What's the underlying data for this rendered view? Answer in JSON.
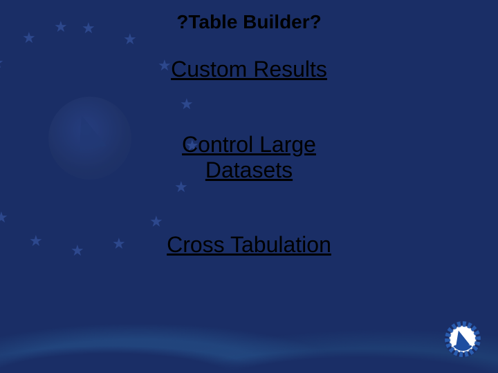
{
  "title": "?Table Builder?",
  "links": {
    "custom_results": "Custom Results",
    "control_large_datasets_l1": "Control Large",
    "control_large_datasets_l2": "Datasets",
    "cross_tabulation": "Cross Tabulation"
  }
}
